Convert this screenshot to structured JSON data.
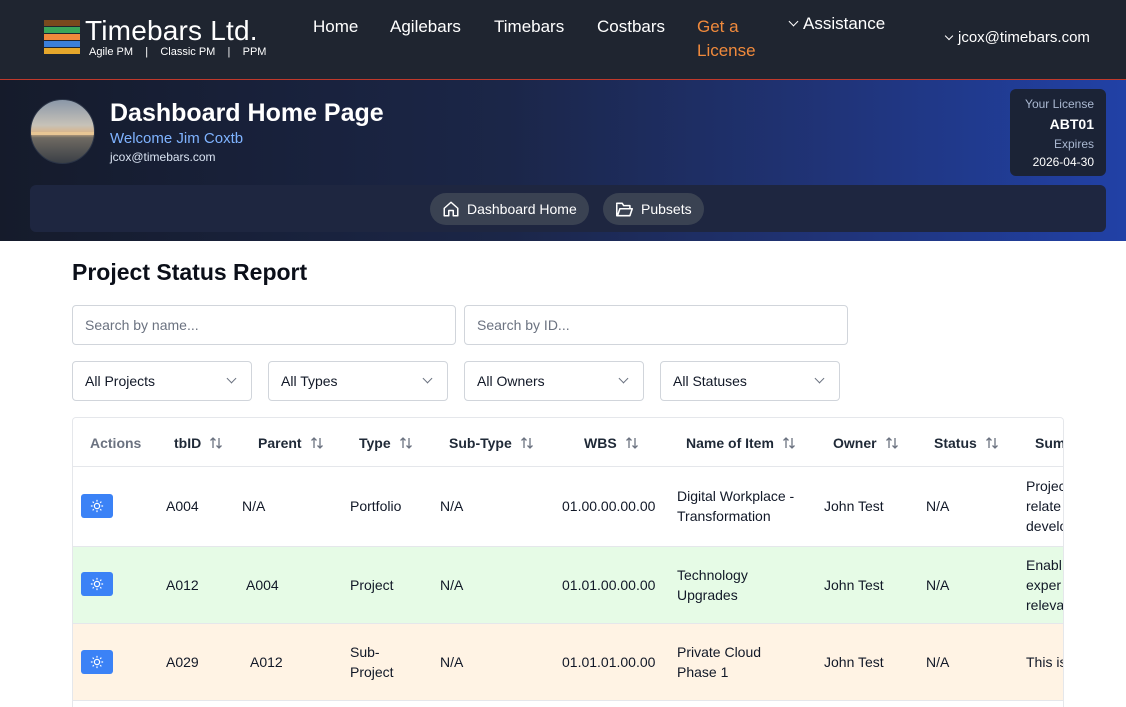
{
  "header": {
    "brand": "Timebars Ltd.",
    "tagline": "Agile PM    |    Classic PM    |    PPM",
    "nav": [
      {
        "label": "Home"
      },
      {
        "label": "Agilebars"
      },
      {
        "label": "Timebars"
      },
      {
        "label": "Costbars"
      },
      {
        "label_line1": "Get a",
        "label_line2": "License"
      },
      {
        "label": "Assistance"
      }
    ],
    "user_menu": "jcox@timebars.com",
    "logo_colors": [
      "#7a4a1e",
      "#3aa65a",
      "#f08a3c",
      "#3b7fd9",
      "#e5a72b"
    ],
    "accent_color": "#f08a3c"
  },
  "hero": {
    "title": "Dashboard Home Page",
    "welcome": "Welcome Jim Coxtb",
    "email": "jcox@timebars.com",
    "license": {
      "label": "Your License",
      "code": "ABT01",
      "expires_label": "Expires",
      "expires_date": "2026-04-30"
    },
    "subnav": [
      {
        "label": "Dashboard Home",
        "icon": "home-icon"
      },
      {
        "label": "Pubsets",
        "icon": "folder-icon"
      }
    ]
  },
  "report": {
    "title": "Project Status Report",
    "search_name_placeholder": "Search by name...",
    "search_id_placeholder": "Search by ID...",
    "filters": {
      "projects": "All Projects",
      "types": "All Types",
      "owners": "All Owners",
      "statuses": "All Statuses"
    },
    "columns": {
      "actions": "Actions",
      "tbid": "tbID",
      "parent": "Parent",
      "type": "Type",
      "subtype": "Sub-Type",
      "wbs": "WBS",
      "name": "Name of Item",
      "owner": "Owner",
      "status": "Status",
      "summary": "Sum"
    },
    "rows": [
      {
        "tbid": "A004",
        "parent": "N/A",
        "type": "Portfolio",
        "subtype": "N/A",
        "wbs": "01.00.00.00.00",
        "name": "Digital Workplace - Transformation",
        "owner": "John Test",
        "status": "N/A",
        "summary_1": "Projec",
        "summary_2": "relate",
        "summary_3": "develo",
        "bg": "#ffffff"
      },
      {
        "tbid": "A012",
        "parent": "A004",
        "type": "Project",
        "subtype": "N/A",
        "wbs": "01.01.00.00.00",
        "name": "Technology Upgrades",
        "owner": "John Test",
        "status": "N/A",
        "summary_1": "Enabl",
        "summary_2": "exper",
        "summary_3": "releva",
        "bg": "#e6fbe6"
      },
      {
        "tbid": "A029",
        "parent": "A012",
        "type": "Sub-Project",
        "subtype": "N/A",
        "wbs": "01.01.01.00.00",
        "name": "Private Cloud Phase 1",
        "owner": "John Test",
        "status": "N/A",
        "summary_1": "This is",
        "summary_2": "",
        "summary_3": "",
        "bg": "#fff3e4"
      }
    ]
  }
}
